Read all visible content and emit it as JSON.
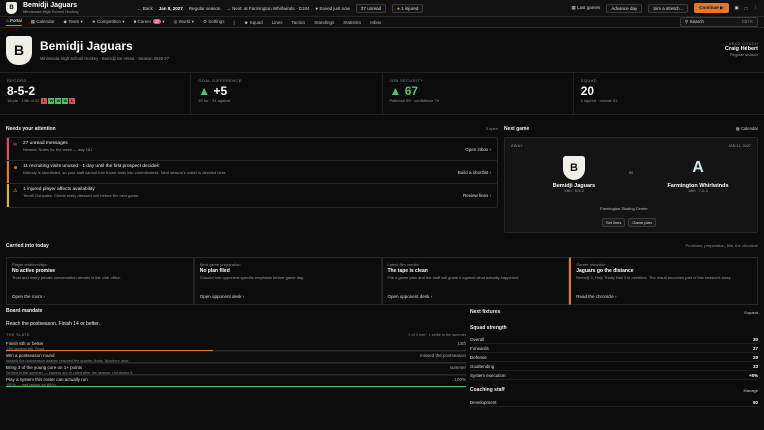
{
  "top": {
    "team": "Bemidji Jaguars",
    "league": "Minnesota High School Hockey",
    "back": "Back",
    "date": "Jan 8, 2027",
    "season": "Regular season",
    "next": "Next: at Farmington Whirlwinds · D184",
    "saved": "Saved just now",
    "unread": "37 unread",
    "injured": "1 injured",
    "last_games": "Last games",
    "advance": "Advance day",
    "sim": "Sim a stretch...",
    "continue": "Continue",
    "search": "Search",
    "shortcut": "Ctrl K"
  },
  "nav": [
    {
      "label": "Portal"
    },
    {
      "label": "Calendar"
    },
    {
      "label": "Team"
    },
    {
      "label": "Competition"
    },
    {
      "label": "Career",
      "badge": "37"
    },
    {
      "label": "World"
    },
    {
      "label": "Settings"
    },
    {
      "label": "Squad"
    },
    {
      "label": "Lines"
    },
    {
      "label": "Tactics"
    },
    {
      "label": "Standings"
    },
    {
      "label": "Statistics"
    },
    {
      "label": "Inbox"
    }
  ],
  "hero": {
    "name": "Bemidji Jaguars",
    "sub": "Minnesota High School Hockey · Bemidji Ice Arena · Season 2026-27",
    "coach_label": "HEAD COACH",
    "coach": "Craig Hébert",
    "coach_sub": "Regular season"
  },
  "stats": [
    {
      "label": "RECORD",
      "value": "8-5-2",
      "sub": "18 pts · 13th of 32"
    },
    {
      "label": "GOAL DIFFERENCE",
      "value": "+5",
      "sub": "39 for · 34 against"
    },
    {
      "label": "JOB SECURITY",
      "value": "67",
      "sub": "Patience 65 · confidence 76"
    },
    {
      "label": "SQUAD",
      "value": "20",
      "sub": "1 injured · morale 63"
    }
  ],
  "form": [
    "L",
    "W",
    "W",
    "W",
    "L"
  ],
  "attention": {
    "title": "Needs your attention",
    "count": "3 open",
    "items": [
      {
        "title": "27 unread messages",
        "desc": "Newest: Notes for the week — day 181",
        "link": "Open inbox",
        "color": "#e04b55",
        "icon": "mail-icon"
      },
      {
        "title": "11 recruiting visits unused · 1 day until the first prospect decides",
        "desc": "Nobody is shortlisted, so your staff cannot turn those visits into commitments. Next season's roster is decided here.",
        "link": "Build a shortlist",
        "color": "#e3782b",
        "icon": "people-icon"
      },
      {
        "title": "1 injured player affects availability",
        "desc": "Terrell Gonzalez. Check every dressed unit before the next game.",
        "link": "Review lines",
        "color": "#e3b42b",
        "icon": "medical-icon"
      }
    ]
  },
  "next_game": {
    "title": "Next game",
    "calendar": "Calendar",
    "away": "AWAY",
    "date": "JAN 11, 2027",
    "home_team": "Bemidji Jaguars",
    "home_sub": "13th · 8-5-2",
    "at": "at",
    "opp": "Farmington Whirlwinds",
    "opp_sub": "16th · 7-8-3",
    "venue": "Farmington Skating Center",
    "set_lines": "Set lines",
    "game_plan": "Game plan"
  },
  "carried": {
    "title": "Carried into today",
    "meta": "Promises, preparation, film, the chronicle",
    "cards": [
      {
        "label": "Player relationships",
        "title": "No active promise",
        "desc": "Trust and every private conversation remain in the club office.",
        "action": "Open the room"
      },
      {
        "label": "Next game preparation",
        "title": "No plan filed",
        "desc": "Choose one opponent-specific emphasis before game day.",
        "action": "Open opponent desk"
      },
      {
        "label": "Latest film verdict",
        "title": "The tape is clean",
        "desc": "File a game plan and the staff will grade it against what actually happened.",
        "action": "Open opponent desk"
      },
      {
        "label": "Career chronicle",
        "title": "Jaguars go the distance",
        "desc": "Bemidji 2, Holy Trinity Hall 3 in overtime. The result becomes part of this season's story.",
        "action": "Read the chronicle"
      }
    ]
  },
  "board": {
    "title": "Board mandate",
    "mandate": "Reach the postseason. Finish 14 or better.",
    "slate": "THE SLATE",
    "slate_meta": "2 of 4 met · 1 settle in the summer",
    "goals": [
      {
        "title": "Finish 8th or better",
        "value": "13th",
        "detail": "13th against 8th. Short.",
        "fill": 0.45,
        "color": "#e3782b"
      },
      {
        "title": "Win a postseason round",
        "value": "missed the postseason",
        "detail": "missed the postseason against reached the quarter-finals. Nowhere near.",
        "fill": 0.0,
        "color": "#e04b55"
      },
      {
        "title": "Bring 3 of the young core on 1+ points",
        "value": "summer",
        "detail": "Settled in the summer — players are re-rated after the season, not during it.",
        "fill": 0.0,
        "color": "#888"
      },
      {
        "title": "Play a system this roster can actually run",
        "value": "100%",
        "detail": "100% — met (asked for 85%).",
        "fill": 1.0,
        "color": "#4cc36a"
      }
    ]
  },
  "fixtures": {
    "title": "Next fixtures",
    "expand": "Expand"
  },
  "squad_strength": {
    "title": "Squad strength",
    "rows": [
      {
        "label": "Overall",
        "value": "30"
      },
      {
        "label": "Forwards",
        "value": "27"
      },
      {
        "label": "Defense",
        "value": "29"
      },
      {
        "label": "Goaltending",
        "value": "33"
      },
      {
        "label": "System execution",
        "value": "+5%"
      }
    ]
  },
  "coaching": {
    "title": "Coaching staff",
    "manage": "Manage",
    "rows": [
      {
        "label": "Development",
        "value": "50"
      }
    ]
  }
}
